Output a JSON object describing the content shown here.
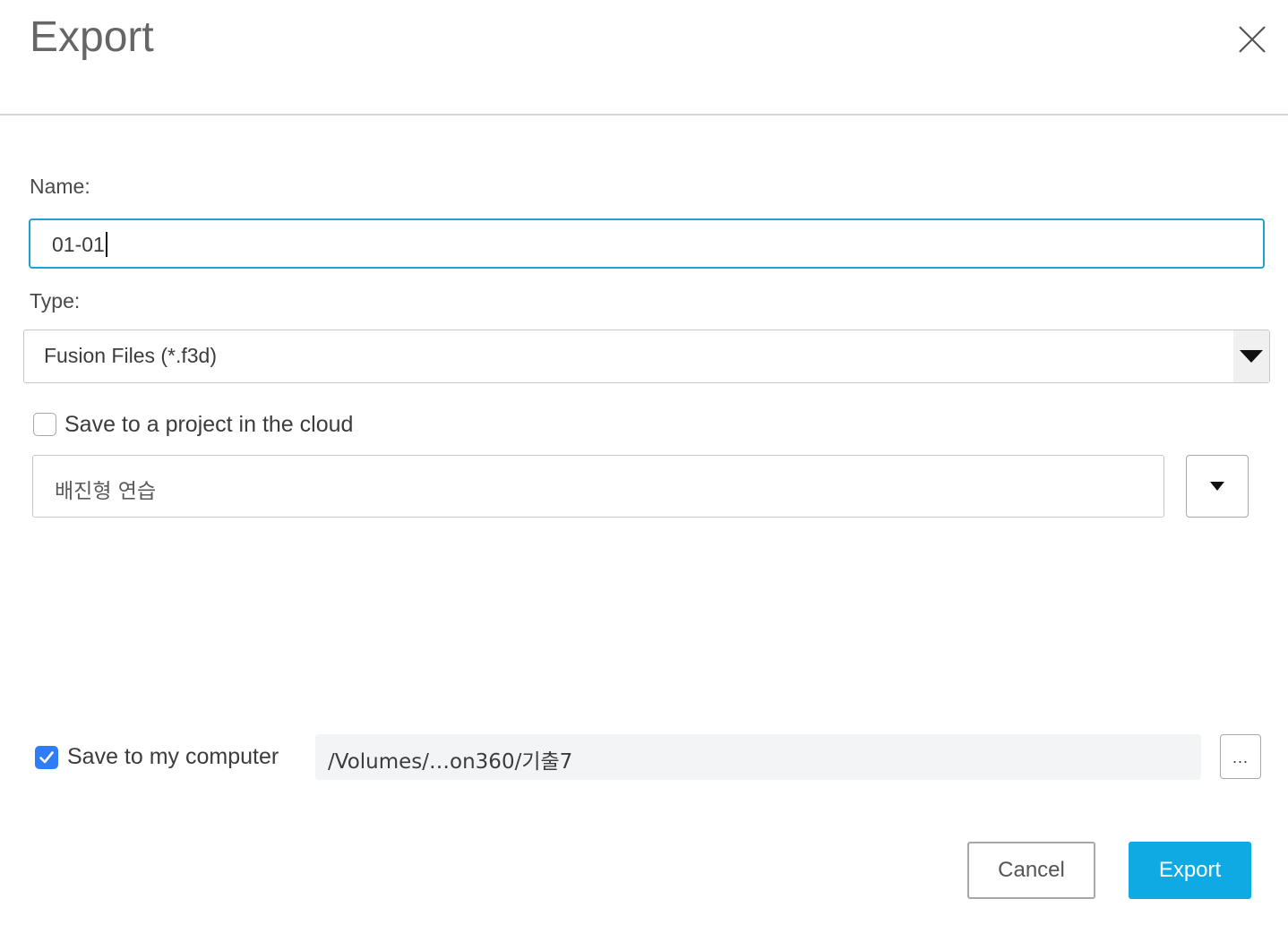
{
  "dialog": {
    "title": "Export",
    "close_icon": "close-icon"
  },
  "name": {
    "label": "Name:",
    "value": "01-01"
  },
  "type": {
    "label": "Type:",
    "selected": "Fusion Files (*.f3d)",
    "arrow_icon": "caret-down-icon"
  },
  "cloud": {
    "checkbox_checked": false,
    "label": "Save to a project in the cloud",
    "project_value": "배진형 연습",
    "dropdown_icon": "caret-down-icon"
  },
  "computer": {
    "checkbox_checked": true,
    "label": "Save to my computer",
    "path_value": "/Volumes/…on360/기출7",
    "browse_label": "..."
  },
  "footer": {
    "cancel_label": "Cancel",
    "export_label": "Export"
  },
  "colors": {
    "accent": "#1fa1d6",
    "primary_button": "#0faae3",
    "checkbox_checked": "#2e7cf6",
    "divider": "#d6d6d6",
    "path_field_bg": "#f3f4f6"
  }
}
